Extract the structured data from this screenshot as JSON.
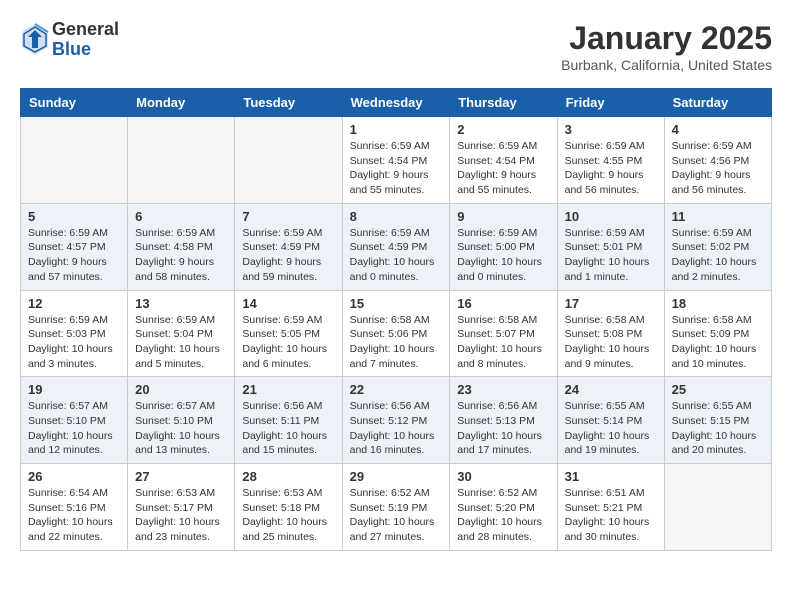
{
  "header": {
    "logo": {
      "general": "General",
      "blue": "Blue"
    },
    "title": "January 2025",
    "location": "Burbank, California, United States"
  },
  "calendar": {
    "weekdays": [
      "Sunday",
      "Monday",
      "Tuesday",
      "Wednesday",
      "Thursday",
      "Friday",
      "Saturday"
    ],
    "weeks": [
      [
        {
          "day": "",
          "info": ""
        },
        {
          "day": "",
          "info": ""
        },
        {
          "day": "",
          "info": ""
        },
        {
          "day": "1",
          "info": "Sunrise: 6:59 AM\nSunset: 4:54 PM\nDaylight: 9 hours\nand 55 minutes."
        },
        {
          "day": "2",
          "info": "Sunrise: 6:59 AM\nSunset: 4:54 PM\nDaylight: 9 hours\nand 55 minutes."
        },
        {
          "day": "3",
          "info": "Sunrise: 6:59 AM\nSunset: 4:55 PM\nDaylight: 9 hours\nand 56 minutes."
        },
        {
          "day": "4",
          "info": "Sunrise: 6:59 AM\nSunset: 4:56 PM\nDaylight: 9 hours\nand 56 minutes."
        }
      ],
      [
        {
          "day": "5",
          "info": "Sunrise: 6:59 AM\nSunset: 4:57 PM\nDaylight: 9 hours\nand 57 minutes."
        },
        {
          "day": "6",
          "info": "Sunrise: 6:59 AM\nSunset: 4:58 PM\nDaylight: 9 hours\nand 58 minutes."
        },
        {
          "day": "7",
          "info": "Sunrise: 6:59 AM\nSunset: 4:59 PM\nDaylight: 9 hours\nand 59 minutes."
        },
        {
          "day": "8",
          "info": "Sunrise: 6:59 AM\nSunset: 4:59 PM\nDaylight: 10 hours\nand 0 minutes."
        },
        {
          "day": "9",
          "info": "Sunrise: 6:59 AM\nSunset: 5:00 PM\nDaylight: 10 hours\nand 0 minutes."
        },
        {
          "day": "10",
          "info": "Sunrise: 6:59 AM\nSunset: 5:01 PM\nDaylight: 10 hours\nand 1 minute."
        },
        {
          "day": "11",
          "info": "Sunrise: 6:59 AM\nSunset: 5:02 PM\nDaylight: 10 hours\nand 2 minutes."
        }
      ],
      [
        {
          "day": "12",
          "info": "Sunrise: 6:59 AM\nSunset: 5:03 PM\nDaylight: 10 hours\nand 3 minutes."
        },
        {
          "day": "13",
          "info": "Sunrise: 6:59 AM\nSunset: 5:04 PM\nDaylight: 10 hours\nand 5 minutes."
        },
        {
          "day": "14",
          "info": "Sunrise: 6:59 AM\nSunset: 5:05 PM\nDaylight: 10 hours\nand 6 minutes."
        },
        {
          "day": "15",
          "info": "Sunrise: 6:58 AM\nSunset: 5:06 PM\nDaylight: 10 hours\nand 7 minutes."
        },
        {
          "day": "16",
          "info": "Sunrise: 6:58 AM\nSunset: 5:07 PM\nDaylight: 10 hours\nand 8 minutes."
        },
        {
          "day": "17",
          "info": "Sunrise: 6:58 AM\nSunset: 5:08 PM\nDaylight: 10 hours\nand 9 minutes."
        },
        {
          "day": "18",
          "info": "Sunrise: 6:58 AM\nSunset: 5:09 PM\nDaylight: 10 hours\nand 10 minutes."
        }
      ],
      [
        {
          "day": "19",
          "info": "Sunrise: 6:57 AM\nSunset: 5:10 PM\nDaylight: 10 hours\nand 12 minutes."
        },
        {
          "day": "20",
          "info": "Sunrise: 6:57 AM\nSunset: 5:10 PM\nDaylight: 10 hours\nand 13 minutes."
        },
        {
          "day": "21",
          "info": "Sunrise: 6:56 AM\nSunset: 5:11 PM\nDaylight: 10 hours\nand 15 minutes."
        },
        {
          "day": "22",
          "info": "Sunrise: 6:56 AM\nSunset: 5:12 PM\nDaylight: 10 hours\nand 16 minutes."
        },
        {
          "day": "23",
          "info": "Sunrise: 6:56 AM\nSunset: 5:13 PM\nDaylight: 10 hours\nand 17 minutes."
        },
        {
          "day": "24",
          "info": "Sunrise: 6:55 AM\nSunset: 5:14 PM\nDaylight: 10 hours\nand 19 minutes."
        },
        {
          "day": "25",
          "info": "Sunrise: 6:55 AM\nSunset: 5:15 PM\nDaylight: 10 hours\nand 20 minutes."
        }
      ],
      [
        {
          "day": "26",
          "info": "Sunrise: 6:54 AM\nSunset: 5:16 PM\nDaylight: 10 hours\nand 22 minutes."
        },
        {
          "day": "27",
          "info": "Sunrise: 6:53 AM\nSunset: 5:17 PM\nDaylight: 10 hours\nand 23 minutes."
        },
        {
          "day": "28",
          "info": "Sunrise: 6:53 AM\nSunset: 5:18 PM\nDaylight: 10 hours\nand 25 minutes."
        },
        {
          "day": "29",
          "info": "Sunrise: 6:52 AM\nSunset: 5:19 PM\nDaylight: 10 hours\nand 27 minutes."
        },
        {
          "day": "30",
          "info": "Sunrise: 6:52 AM\nSunset: 5:20 PM\nDaylight: 10 hours\nand 28 minutes."
        },
        {
          "day": "31",
          "info": "Sunrise: 6:51 AM\nSunset: 5:21 PM\nDaylight: 10 hours\nand 30 minutes."
        },
        {
          "day": "",
          "info": ""
        }
      ]
    ]
  }
}
